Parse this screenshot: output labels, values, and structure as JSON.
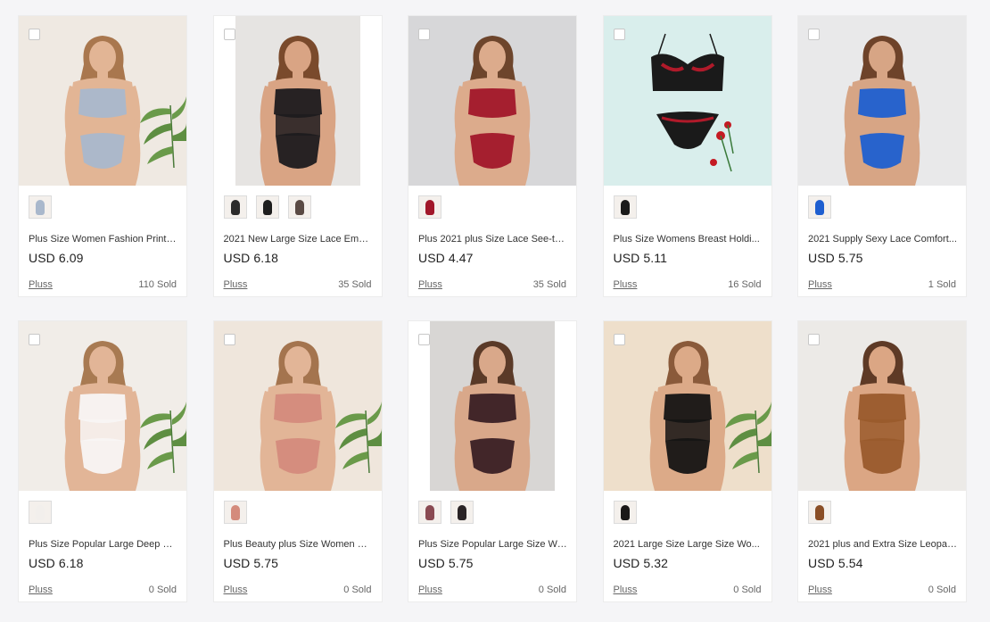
{
  "products": [
    {
      "title": "Plus Size Women Fashion Printe...",
      "price": "USD 6.09",
      "store": "Pluss",
      "sold": "110 Sold",
      "bg": "#efe9e2",
      "outfit": "#a9b8cc",
      "skin": "#e2b595",
      "hair": "#a9774e",
      "plant": true,
      "narrow": false,
      "swatches": [
        "#a9b8cc"
      ]
    },
    {
      "title": "2021 New Large Size Lace Embr...",
      "price": "USD 6.18",
      "store": "Pluss",
      "sold": "35 Sold",
      "bg": "#e6e4e2",
      "outfit": "#1d1b1d",
      "skin": "#d9a484",
      "hair": "#7a4a2c",
      "plant": false,
      "narrow": true,
      "swatches": [
        "#2b2b2b",
        "#1e1e1e",
        "#5a4a44"
      ]
    },
    {
      "title": "Plus 2021 plus Size Lace See-thr...",
      "price": "USD 4.47",
      "store": "Pluss",
      "sold": "35 Sold",
      "bg": "#d7d7d9",
      "outfit": "#a1172a",
      "skin": "#dcab8c",
      "hair": "#6d452c",
      "plant": false,
      "narrow": false,
      "swatches": [
        "#a1172a"
      ]
    },
    {
      "title": "Plus Size Womens Breast Holdi...",
      "price": "USD 5.11",
      "store": "Pluss",
      "sold": "16 Sold",
      "bg": "#d9eeec",
      "outfit": "#1a1a1a",
      "skin": "#d9eeec",
      "hair": "#d9eeec",
      "plant": false,
      "narrow": false,
      "swatches": [
        "#1a1a1a"
      ]
    },
    {
      "title": "2021 Supply Sexy Lace Comfort...",
      "price": "USD 5.75",
      "store": "Pluss",
      "sold": "1 Sold",
      "bg": "#e9e9ea",
      "outfit": "#1f5fd0",
      "skin": "#d7a585",
      "hair": "#6e432a",
      "plant": false,
      "narrow": false,
      "swatches": [
        "#1f5fd0"
      ]
    },
    {
      "title": "Plus Size Popular Large Deep V ...",
      "price": "USD 6.18",
      "store": "Pluss",
      "sold": "0 Sold",
      "bg": "#f1ede8",
      "outfit": "#f8f6f4",
      "skin": "#e2b597",
      "hair": "#a87a52",
      "plant": true,
      "narrow": false,
      "swatches": [
        "#f2efec"
      ]
    },
    {
      "title": "Plus Beauty plus Size Women Cl...",
      "price": "USD 5.75",
      "store": "Pluss",
      "sold": "0 Sold",
      "bg": "#efe6dc",
      "outfit": "#d48b7c",
      "skin": "#e2b597",
      "hair": "#a4744e",
      "plant": true,
      "narrow": false,
      "swatches": [
        "#d48b7c"
      ]
    },
    {
      "title": "Plus Size Popular Large Size Wo...",
      "price": "USD 5.75",
      "store": "Pluss",
      "sold": "0 Sold",
      "bg": "#d8d6d4",
      "outfit": "#3a1f24",
      "skin": "#d9a88a",
      "hair": "#5a3a28",
      "plant": false,
      "narrow": true,
      "swatches": [
        "#8a4a52",
        "#2a2426"
      ]
    },
    {
      "title": "2021 Large Size Large Size Wo...",
      "price": "USD 5.32",
      "store": "Pluss",
      "sold": "0 Sold",
      "bg": "#eedfcb",
      "outfit": "#151414",
      "skin": "#dcaa88",
      "hair": "#8a5a3a",
      "plant": true,
      "narrow": false,
      "swatches": [
        "#1a1818"
      ]
    },
    {
      "title": "2021 plus and Extra Size Leopar...",
      "price": "USD 5.54",
      "store": "Pluss",
      "sold": "0 Sold",
      "bg": "#eceae7",
      "outfit": "#9a5a2c",
      "skin": "#dba684",
      "hair": "#5e3a26",
      "plant": false,
      "narrow": false,
      "swatches": [
        "#8a4e26"
      ]
    }
  ]
}
